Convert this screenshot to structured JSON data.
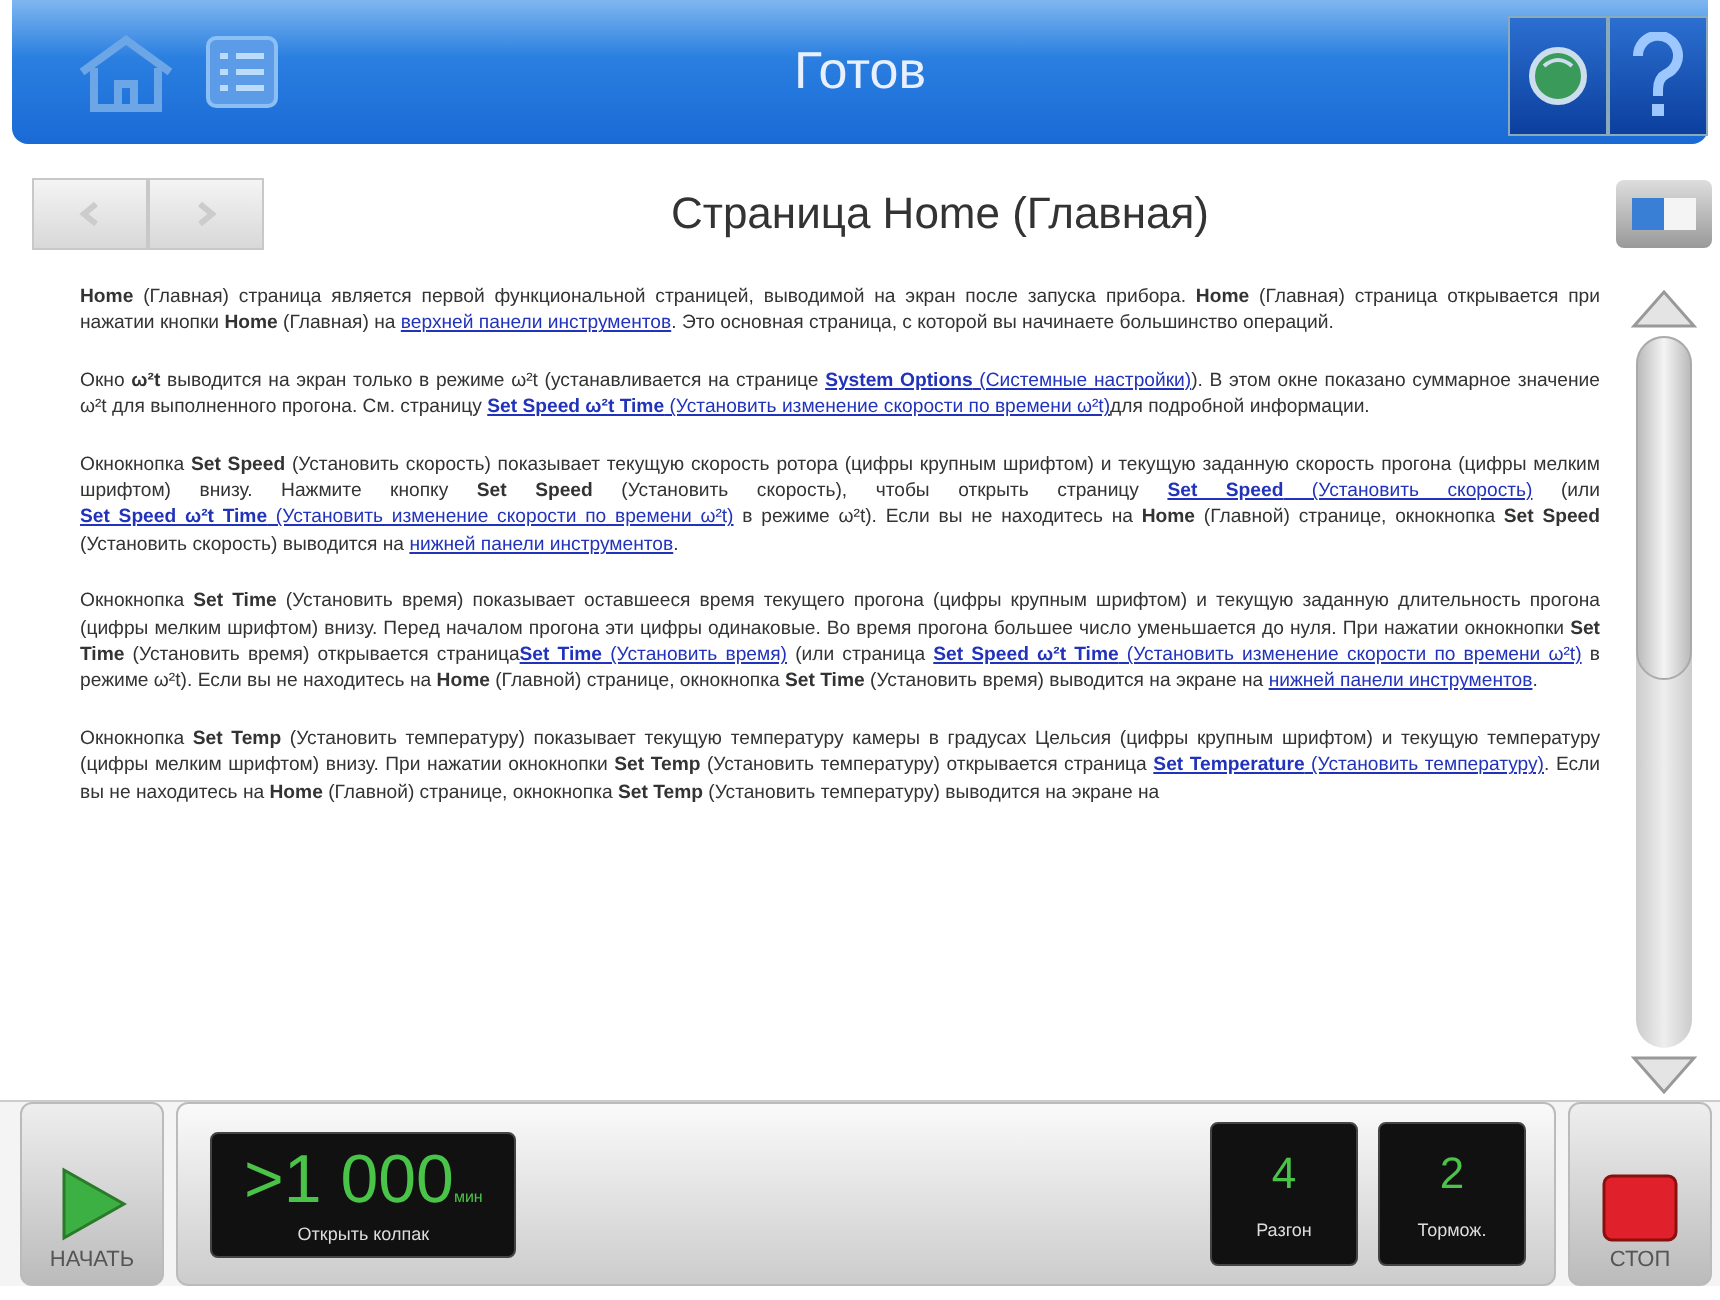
{
  "header": {
    "title": "Готов"
  },
  "page": {
    "title": "Страница Home (Главная)",
    "back_disabled": true,
    "forward_disabled": true
  },
  "paragraphs": [
    [
      {
        "kind": "text",
        "text": "**Home** (Главная) страница является первой функциональной страницей, выводимой на экран после запуска прибора. **Home** (Главная) страница открывается при нажатии кнопки **Home** (Главная) на "
      },
      {
        "kind": "link",
        "text": "верхней панели инструментов"
      },
      {
        "kind": "text",
        "text": ". Это основная страница, с которой вы начинаете большинство операций."
      }
    ],
    [
      {
        "kind": "text",
        "text": "Окно **ω²t** выводится на экран только в режиме ω²t (устанавливается на странице "
      },
      {
        "kind": "link",
        "text": "**System Options** (Системные настройки)"
      },
      {
        "kind": "text",
        "text": "). В этом окне показано суммарное значение ω²t для выполненного прогона. См. страницу "
      },
      {
        "kind": "link",
        "text": "**Set Speed ω²t Time** (Установить изменение скорости по времени ω²t)"
      },
      {
        "kind": "text",
        "text": "для подробной информации."
      }
    ],
    [
      {
        "kind": "text",
        "text": "Окнокнопка **Set Speed** (Установить скорость) показывает текущую скорость ротора (цифры крупным шрифтом) и текущую заданную скорость прогона (цифры мелким шрифтом) внизу. Нажмите кнопку **Set Speed** (Установить скорость), чтобы открыть страницу "
      },
      {
        "kind": "link",
        "text": "**Set Speed** (Установить скорость)"
      },
      {
        "kind": "text",
        "text": " (или "
      },
      {
        "kind": "link",
        "text": "**Set Speed ω²t Time** (Установить изменение скорости по времени ω²t)"
      },
      {
        "kind": "text",
        "text": " в режиме ω²t). Если вы не находитесь на **Home** (Главной) странице, окнокнопка **Set Speed** (Установить скорость) выводится на "
      },
      {
        "kind": "link",
        "text": "нижней панели инструментов"
      },
      {
        "kind": "text",
        "text": "."
      }
    ],
    [
      {
        "kind": "text",
        "text": "Окнокнопка **Set Time** (Установить время) показывает оставшееся время текущего прогона (цифры крупным шрифтом) и текущую заданную длительность прогона (цифры мелким шрифтом) внизу. Перед началом прогона эти цифры одинаковые. Во время прогона большее число уменьшается до нуля. При нажатии окнокнопки **Set Time** (Установить время) открывается страница"
      },
      {
        "kind": "link",
        "text": "**Set Time** (Установить время)"
      },
      {
        "kind": "text",
        "text": " (или страница "
      },
      {
        "kind": "link",
        "text": "**Set Speed ω²t Time** (Установить изменение скорости по времени ω²t)"
      },
      {
        "kind": "text",
        "text": " в режиме ω²t). Если вы не находитесь на **Home** (Главной) странице, окнокнопка **Set Time** (Установить время) выводится на экране на "
      },
      {
        "kind": "link",
        "text": "нижней панели инструментов"
      },
      {
        "kind": "text",
        "text": "."
      }
    ],
    [
      {
        "kind": "text",
        "text": "Окнокнопка **Set Temp** (Установить температуру) показывает текущую температуру камеры в градусах Цельсия (цифры крупным шрифтом) и текущую температуру (цифры мелким шрифтом) внизу. При нажатии окнокнопки **Set Temp** (Установить температуру) открывается страница "
      },
      {
        "kind": "link",
        "text": "**Set Temperature** (Установить температуру)"
      },
      {
        "kind": "text",
        "text": ". Если вы не находитесь на **Home** (Главной) странице, окнокнопка **Set Temp** (Установить температуру) выводится на экране на"
      }
    ]
  ],
  "bottom": {
    "start_label": "НАЧАТЬ",
    "display": {
      "value": ">1 000",
      "unit": "мин",
      "caption": "Открыть колпак"
    },
    "tiles": [
      {
        "value": "4",
        "caption": "Разгон"
      },
      {
        "value": "2",
        "caption": "Тормож."
      }
    ],
    "stop_label": "СТОП"
  }
}
